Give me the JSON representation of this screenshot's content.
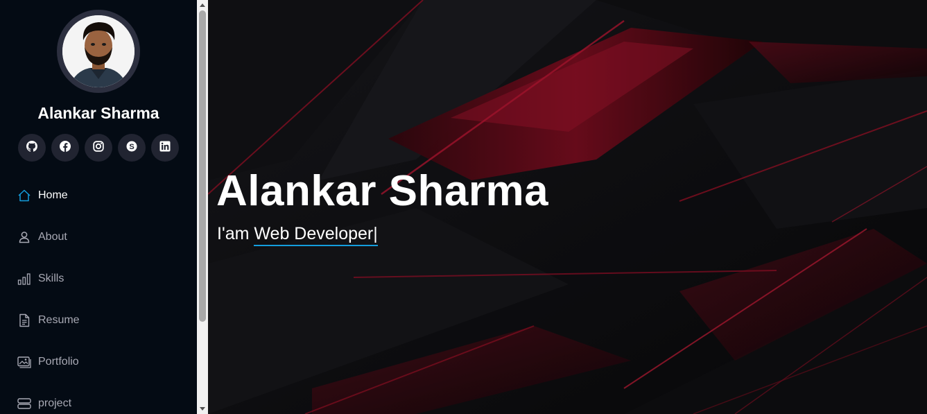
{
  "profile": {
    "name": "Alankar Sharma"
  },
  "social": [
    {
      "icon": "github-icon"
    },
    {
      "icon": "facebook-icon"
    },
    {
      "icon": "instagram-icon"
    },
    {
      "icon": "skype-icon"
    },
    {
      "icon": "linkedin-icon"
    }
  ],
  "nav": {
    "items": [
      {
        "label": "Home",
        "icon": "home-icon",
        "active": true
      },
      {
        "label": "About",
        "icon": "person-icon"
      },
      {
        "label": "Skills",
        "icon": "bar-chart-icon"
      },
      {
        "label": "Resume",
        "icon": "document-icon"
      },
      {
        "label": "Portfolio",
        "icon": "images-icon"
      },
      {
        "label": "project",
        "icon": "server-icon"
      }
    ]
  },
  "hero": {
    "title": "Alankar Sharma",
    "prefix": "I'am ",
    "typed": "Web Developer",
    "cursor": "|"
  },
  "colors": {
    "sidebar_bg": "#040b14",
    "accent": "#149ddd",
    "nav_text": "#a8a9b4",
    "hero_red": "#a3112b"
  }
}
